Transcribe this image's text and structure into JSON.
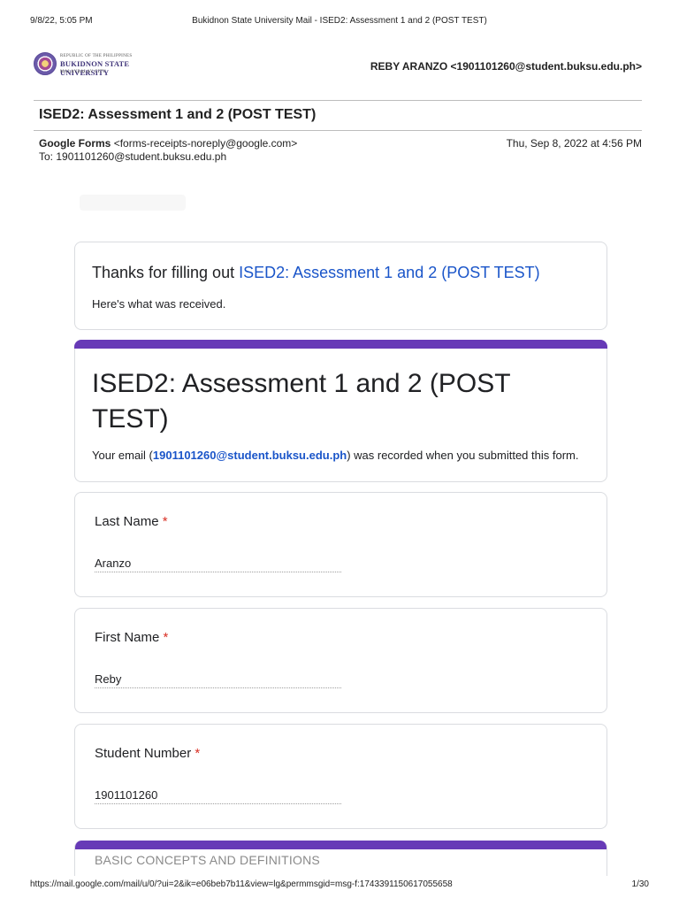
{
  "print_header": {
    "datetime": "9/8/22, 5:05 PM",
    "title": "Bukidnon State University Mail - ISED2: Assessment 1 and 2 (POST TEST)"
  },
  "logo": {
    "line1": "REPUBLIC OF THE PHILIPPINES",
    "line2": "BUKIDNON STATE UNIVERSITY",
    "line3": "MALAYBALAY CITY"
  },
  "account": "REBY ARANZO <1901101260@student.buksu.edu.ph>",
  "subject": "ISED2: Assessment 1 and 2 (POST TEST)",
  "sender": {
    "name": "Google Forms",
    "address": "<forms-receipts-noreply@google.com>",
    "timestamp": "Thu, Sep 8, 2022 at 4:56 PM",
    "to": "To: 1901101260@student.buksu.edu.ph"
  },
  "thanks": {
    "prefix": "Thanks for filling out",
    "form_link": "ISED2: Assessment 1 and 2 (POST TEST)",
    "received": "Here's what was received."
  },
  "form": {
    "title": "ISED2: Assessment 1 and 2 (POST TEST)",
    "email_prefix": "Your email (",
    "email": "1901101260@student.buksu.edu.ph",
    "email_suffix": ") was recorded when you submitted this form.",
    "accent_color": "#673ab7"
  },
  "questions": [
    {
      "label": "Last Name",
      "required": "*",
      "answer": "Aranzo"
    },
    {
      "label": "First Name",
      "required": "*",
      "answer": "Reby"
    },
    {
      "label": "Student Number",
      "required": "*",
      "answer": "1901101260"
    }
  ],
  "section": {
    "title": "BASIC CONCEPTS AND DEFINITIONS"
  },
  "print_footer": {
    "url": "https://mail.google.com/mail/u/0/?ui=2&ik=e06beb7b11&view=lg&permmsgid=msg-f:1743391150617055658",
    "page": "1/30"
  }
}
